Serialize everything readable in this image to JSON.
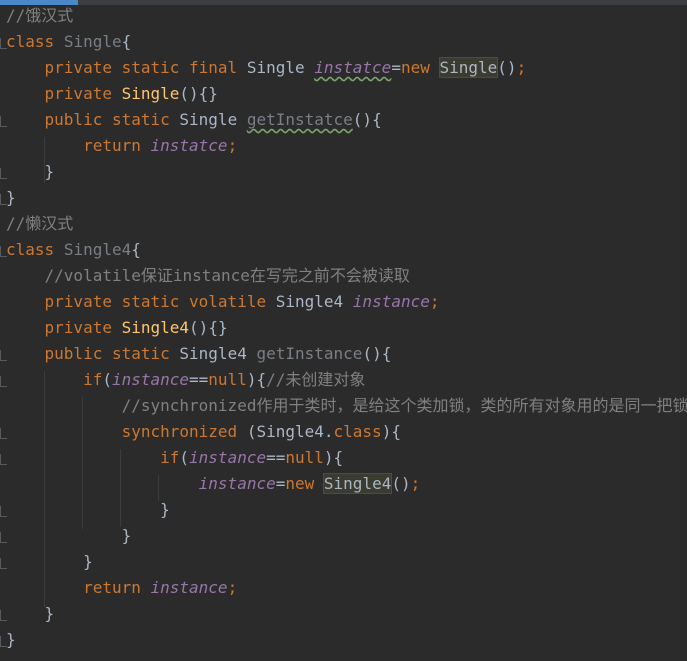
{
  "code": {
    "lines": {
      "l1": {
        "t0": "//饿汉式"
      },
      "l2": {
        "t0": "class",
        "t1": " ",
        "t2": "Single",
        "t3": "{"
      },
      "l3": {
        "t0": "    ",
        "t1": "private static final",
        "t2": " Single ",
        "t3": "instatce",
        "t4": "=",
        "t5": "new",
        "t6": " ",
        "t7": "Single",
        "t8": "()",
        "t9": ";"
      },
      "l4": {
        "t0": "    ",
        "t1": "private",
        "t2": " ",
        "t3": "Single",
        "t4": "(){}"
      },
      "l5": {
        "t0": "    ",
        "t1": "public static",
        "t2": " Single ",
        "t3": "getInstatce",
        "t4": "(){"
      },
      "l6": {
        "t0": "        ",
        "t1": "return",
        "t2": " ",
        "t3": "instatce",
        "t4": ";"
      },
      "l7": {
        "t0": "    }"
      },
      "l8": {
        "t0": "}"
      },
      "l9": {
        "t0": "//懒汉式"
      },
      "l10": {
        "t0": "class",
        "t1": " ",
        "t2": "Single4",
        "t3": "{"
      },
      "l11": {
        "t0": "    ",
        "t1": "//volatile保证instance在写完之前不会被读取"
      },
      "l12": {
        "t0": "    ",
        "t1": "private static volatile",
        "t2": " Single4 ",
        "t3": "instance",
        "t4": ";"
      },
      "l13": {
        "t0": "    ",
        "t1": "private",
        "t2": " ",
        "t3": "Single4",
        "t4": "(){}"
      },
      "l14": {
        "t0": "    ",
        "t1": "public static",
        "t2": " Single4 ",
        "t3": "getInstance",
        "t4": "(){"
      },
      "l15": {
        "t0": "        ",
        "t1": "if",
        "t2": "(",
        "t3": "instance",
        "t4": "==",
        "t5": "null",
        "t6": "){",
        "t7": "//未创建对象"
      },
      "l16": {
        "t0": "            ",
        "t1": "//synchronized作用于类时，是给这个类加锁，类的所有对象用的是同一把锁"
      },
      "l17": {
        "t0": "            ",
        "t1": "synchronized",
        "t2": " (Single4.",
        "t3": "class",
        "t4": "){"
      },
      "l18": {
        "t0": "                ",
        "t1": "if",
        "t2": "(",
        "t3": "instance",
        "t4": "==",
        "t5": "null",
        "t6": "){"
      },
      "l19": {
        "t0": "                    ",
        "t1": "instance",
        "t2": "=",
        "t3": "new",
        "t4": " ",
        "t5": "Single4",
        "t6": "()",
        "t7": ";"
      },
      "l20": {
        "t0": "                }"
      },
      "l21": {
        "t0": "            }"
      },
      "l22": {
        "t0": "        }"
      },
      "l23": {
        "t0": "        ",
        "t1": "return",
        "t2": " ",
        "t3": "instance",
        "t4": ";"
      },
      "l24": {
        "t0": "    }"
      },
      "l25": {
        "t0": "}"
      }
    }
  }
}
